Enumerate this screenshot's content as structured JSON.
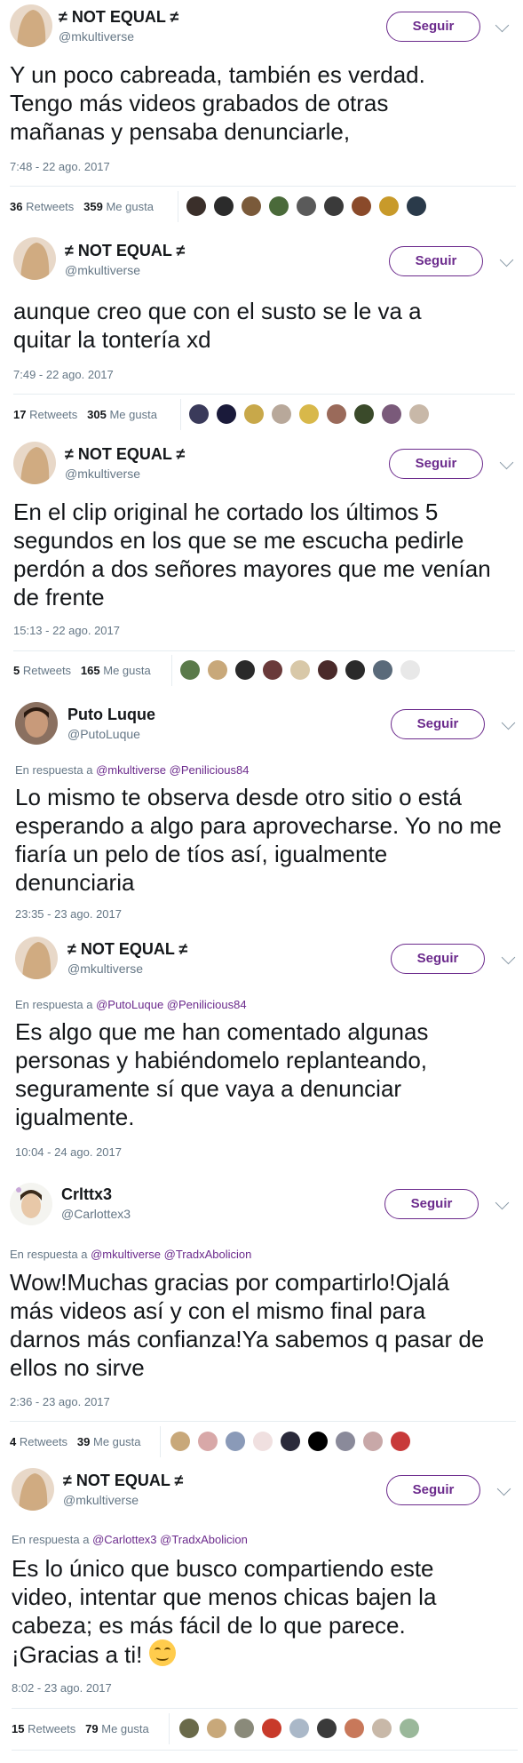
{
  "follow_label": "Seguir",
  "reply_prefix": "En respuesta a",
  "retweets_label": "Retweets",
  "likes_label": "Me gusta",
  "tweets": [
    {
      "name": "≠ NOT EQUAL ≠",
      "handle": "@mkultiverse",
      "text": "Y un poco cabreada, también es verdad. Tengo más videos grabados de otras mañanas y pensaba denunciarle,",
      "timestamp": "7:48 - 22 ago. 2017",
      "retweets": "36",
      "likes": "359",
      "liker_colors": [
        "#3a2f2a",
        "#2b2b2b",
        "#7a5a3a",
        "#4a6a3a",
        "#5a5a5a",
        "#3a3a3a",
        "#8a4a2a",
        "#c89a2a",
        "#2a3a4a"
      ]
    },
    {
      "name": "≠ NOT EQUAL ≠",
      "handle": "@mkultiverse",
      "text": "aunque creo que con el susto se le va a quitar la tontería xd",
      "timestamp": "7:49 - 22 ago. 2017",
      "retweets": "17",
      "likes": "305",
      "liker_colors": [
        "#3a3a5a",
        "#1a1a3a",
        "#c8a84a",
        "#b8a89a",
        "#d8b84a",
        "#9a6a5a",
        "#3a4a2a",
        "#7a5a7a",
        "#c8b8a8"
      ]
    },
    {
      "name": "≠ NOT EQUAL ≠",
      "handle": "@mkultiverse",
      "text": "En el clip original he cortado los últimos 5 segundos en los que se me escucha pedirle perdón a dos señores mayores que me venían de frente",
      "timestamp": "15:13 - 22 ago. 2017",
      "retweets": "5",
      "likes": "165",
      "liker_colors": [
        "#5a7a4a",
        "#c8a87a",
        "#2a2a2a",
        "#6a3a3a",
        "#d8c8a8",
        "#4a2a2a",
        "#2a2a2a",
        "#5a6a7a",
        "#e8e8e8"
      ]
    },
    {
      "name": "Puto Luque",
      "handle": "@PutoLuque",
      "reply_to": "@mkultiverse @Penilicious84",
      "text": "Lo mismo te observa desde otro sitio o está esperando a algo para aprovecharse. Yo no me fiaría un pelo de tíos así, igualmente denunciaria",
      "timestamp": "23:35 - 23 ago. 2017"
    },
    {
      "name": "≠ NOT EQUAL ≠",
      "handle": "@mkultiverse",
      "reply_to": "@PutoLuque @Penilicious84",
      "text": "Es algo que me han comentado algunas personas y habiéndomelo replanteando, seguramente sí que vaya a denunciar igualmente.",
      "timestamp": "10:04 - 24 ago. 2017"
    },
    {
      "name": "Crlttx3",
      "handle": "@Carlottex3",
      "reply_to": "@mkultiverse @TradxAbolicion",
      "text": "Wow!Muchas gracias por compartirlo!Ojalá más videos así y con el mismo final para darnos más confianza!Ya sabemos q pasar de ellos no sirve",
      "timestamp": "2:36 - 23 ago. 2017",
      "retweets": "4",
      "likes": "39",
      "liker_colors": [
        "#c8a87a",
        "#d8a8a8",
        "#8a9ab8",
        "#f0e0e0",
        "#2a2a3a",
        "#000000",
        "#8a8a9a",
        "#c8a8a8",
        "#c83a3a"
      ]
    },
    {
      "name": "≠ NOT EQUAL ≠",
      "handle": "@mkultiverse",
      "reply_to": "@Carlottex3 @TradxAbolicion",
      "text": "Es lo único que busco compartiendo este video, intentar que menos chicas bajen la cabeza; es más fácil de lo que parece. ¡Gracias a ti!",
      "emoji": "smiling-face-icon",
      "timestamp": "8:02 - 23 ago. 2017",
      "retweets": "15",
      "likes": "79",
      "liker_colors": [
        "#6a6a4a",
        "#c8a87a",
        "#8a8a7a",
        "#c83a2a",
        "#aab8c8",
        "#3a3a3a",
        "#c8785a",
        "#c8b8a8",
        "#9ab89a"
      ]
    }
  ]
}
